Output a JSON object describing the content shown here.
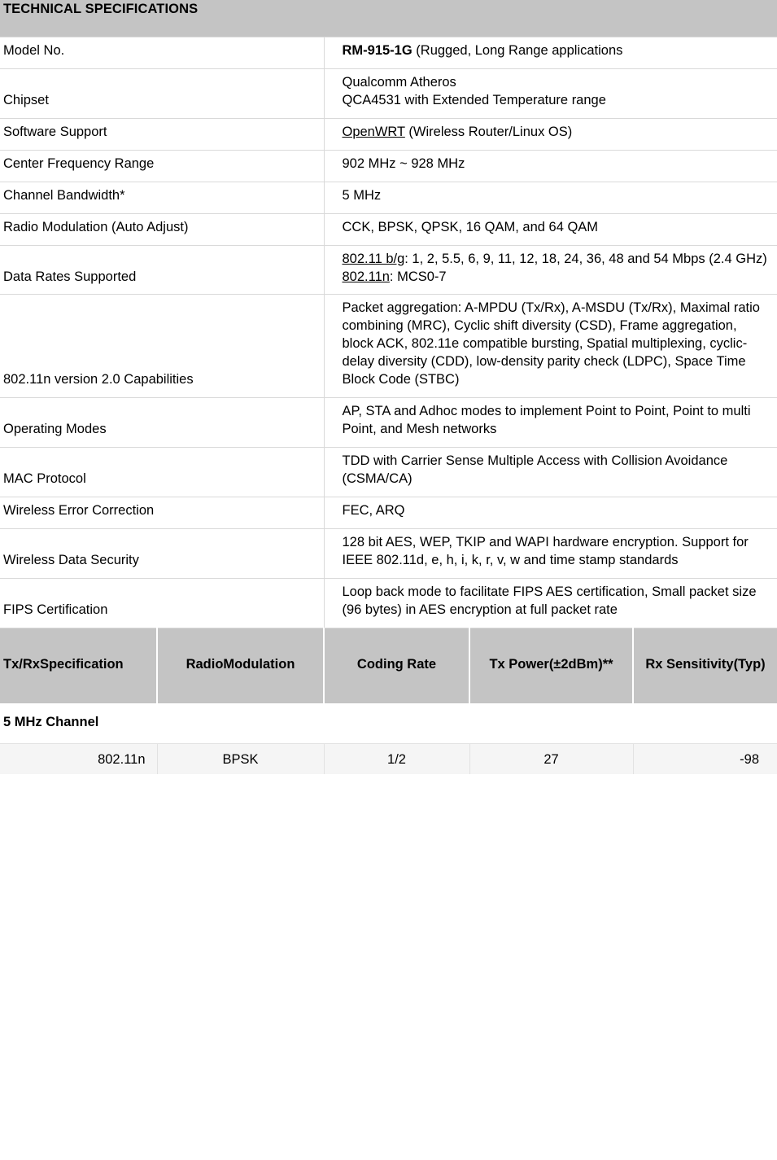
{
  "section": {
    "title": "TECHNICAL SPECIFICATIONS"
  },
  "specs": [
    {
      "label": "Model No.",
      "value_bold": "RM-915-1G",
      "value_rest": " (Rugged, Long Range applications"
    },
    {
      "label": "Chipset",
      "lines": [
        "Qualcomm Atheros",
        "QCA4531 with Extended Temperature range"
      ]
    },
    {
      "label": "Software Support",
      "underline": "OpenWRT",
      "value_rest": " (Wireless Router/Linux OS)"
    },
    {
      "label": "Center Frequency Range",
      "lines": [
        "902 MHz ~ 928 MHz"
      ]
    },
    {
      "label": "Channel Bandwidth*",
      "lines": [
        "5 MHz"
      ]
    },
    {
      "label": "Radio Modulation (Auto Adjust)",
      "lines": [
        "CCK, BPSK, QPSK, 16 QAM, and 64 QAM"
      ]
    },
    {
      "label": "Data Rates Supported",
      "rich": [
        {
          "underline": "802.11 b/g",
          "rest": ": 1, 2, 5.5, 6, 9, 11, 12, 18, 24, 36, 48 and 54 Mbps (2.4 GHz)"
        },
        {
          "underline": "802.11n",
          "rest": ": MCS0-7"
        }
      ]
    },
    {
      "label": "802.11n version 2.0 Capabilities",
      "lines": [
        "Packet aggregation: A-MPDU (Tx/Rx), A-MSDU (Tx/Rx), Maximal ratio combining (MRC), Cyclic shift diversity (CSD), Frame aggregation, block ACK, 802.11e compatible bursting, Spatial multiplexing, cyclic-delay diversity (CDD), low-density parity check (LDPC), Space Time Block Code (STBC)"
      ]
    },
    {
      "label": "Operating Modes",
      "lines": [
        "AP, STA and Adhoc modes to implement Point to Point, Point to multi Point, and Mesh networks"
      ]
    },
    {
      "label": "MAC Protocol",
      "lines": [
        "TDD with Carrier Sense Multiple Access with Collision Avoidance (CSMA/CA)"
      ]
    },
    {
      "label": "Wireless Error Correction",
      "lines": [
        "FEC, ARQ"
      ]
    },
    {
      "label": "Wireless Data Security",
      "lines": [
        "128 bit AES, WEP, TKIP and WAPI hardware encryption. Support for IEEE 802.11d, e, h, i, k, r, v, w and time stamp standards"
      ]
    },
    {
      "label": "FIPS Certification",
      "lines": [
        "Loop back mode to facilitate FIPS AES certification, Small packet size (96 bytes) in AES encryption at full packet rate"
      ]
    }
  ],
  "perf_table": {
    "headers": [
      {
        "line1": "Tx/Rx",
        "line2": "Specification"
      },
      {
        "line1": "Radio",
        "line2": "Modulation"
      },
      {
        "line1": "Coding Rate",
        "line2": ""
      },
      {
        "line1": "Tx Power",
        "line2": "(±2dBm)**"
      },
      {
        "line1": "Rx Sensitivity",
        "line2": "(Typ)"
      }
    ],
    "band_label": "5 MHz Channel",
    "rows": [
      {
        "spec": "802.11n",
        "modulation": "BPSK",
        "coding_rate": "1/2",
        "tx_power": "27",
        "rx_sensitivity": "-98"
      }
    ]
  }
}
